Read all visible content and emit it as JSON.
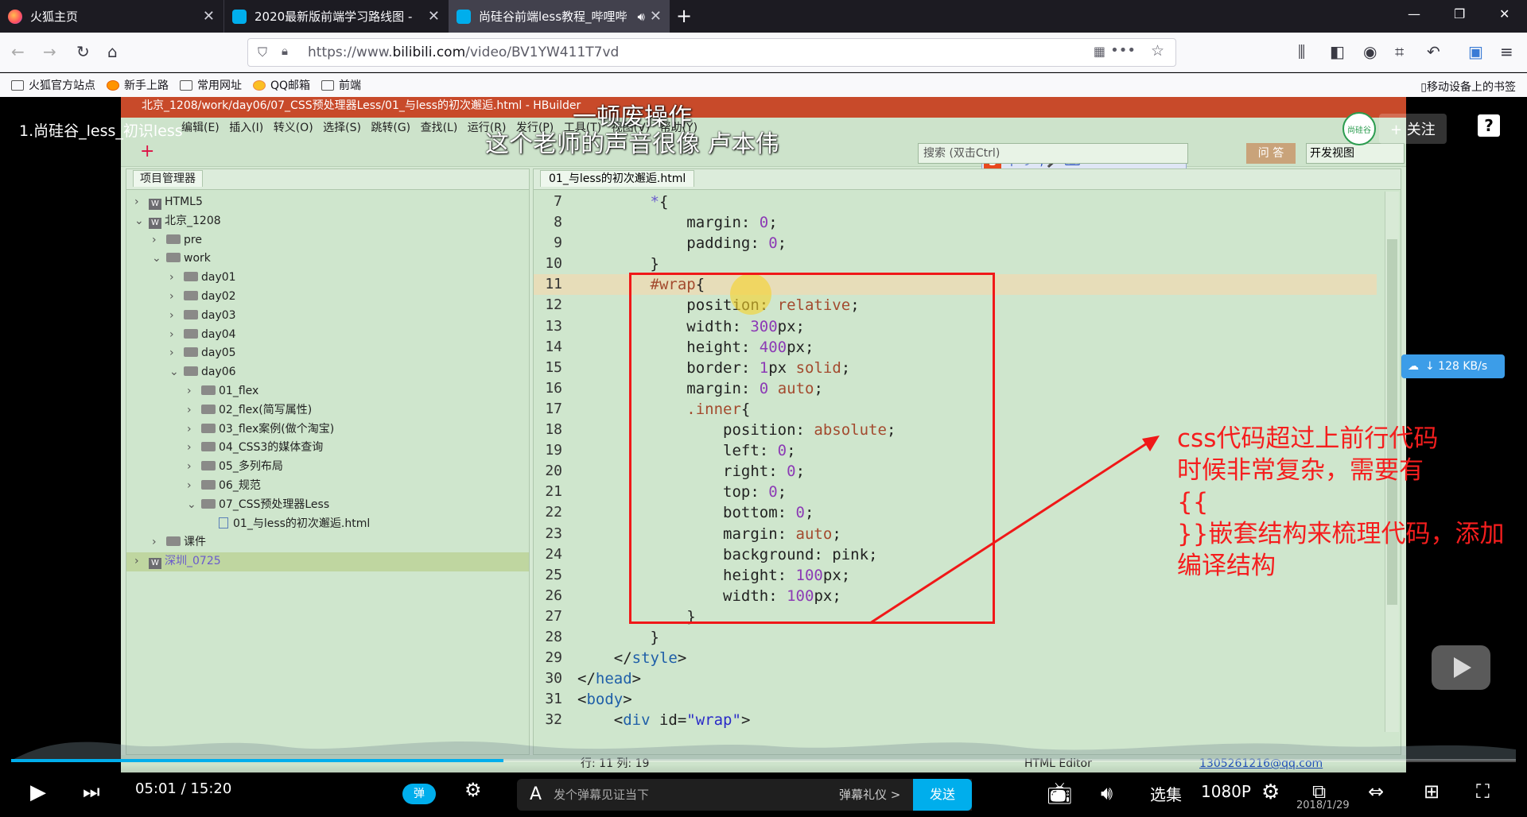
{
  "browser": {
    "tabs": [
      {
        "label": "火狐主页",
        "icon": "firefox-icon",
        "active": false
      },
      {
        "label": "2020最新版前端学习路线图 - ",
        "icon": "bilibili-icon",
        "active": false
      },
      {
        "label": "尚硅谷前端less教程_哔哩哔",
        "icon": "bilibili-icon",
        "active": true
      }
    ],
    "url_prefix": "https://www.",
    "url_domain": "bilibili.com",
    "url_path": "/video/BV1YW411T7vd",
    "bookmarks": [
      "火狐官方站点",
      "新手上路",
      "常用网址",
      "QQ邮箱",
      "前端"
    ],
    "mobile_bookmarks": "移动设备上的书签"
  },
  "video": {
    "title": "1.尚硅谷_less_初识less",
    "danmaku": [
      "一顿废操作",
      "这个老师的声音很像   卢本伟"
    ],
    "follow_label": "+ 关注",
    "avatar_text": "尚硅谷",
    "net_speed": "↓ 128 KB/s",
    "annotation": "css代码超过上前行代码\n时候非常复杂，需要有\n{{\n}}嵌套结构来梳理代码，添加\n编译结构",
    "accent_color": "#00aeec",
    "annotation_color": "#f51e1e"
  },
  "ide": {
    "title": "北京_1208/work/day06/07_CSS预处理器Less/01_与less的初次邂逅.html  -  HBuilder",
    "menu": "编辑(E)  插入(I)  转义(O)  选择(S)  跳转(G)  查找(L)  运行(R)  发行(P)  工具(T)  视图(V)  帮助(Y)",
    "search_placeholder": "搜索 (双击Ctrl)",
    "ask_label": "问 答",
    "view_label": "开发视图",
    "ime_text": "中 ☽ °, 🎤 ⌨",
    "project_panel_title": "项目管理器",
    "tree": [
      {
        "label": "HTML5",
        "depth": 0,
        "kind": "w",
        "arrow": ">"
      },
      {
        "label": "北京_1208",
        "depth": 0,
        "kind": "w",
        "arrow": "v"
      },
      {
        "label": "pre",
        "depth": 1,
        "kind": "folder",
        "arrow": ">"
      },
      {
        "label": "work",
        "depth": 1,
        "kind": "folder",
        "arrow": "v"
      },
      {
        "label": "day01",
        "depth": 2,
        "kind": "folder",
        "arrow": ">"
      },
      {
        "label": "day02",
        "depth": 2,
        "kind": "folder",
        "arrow": ">"
      },
      {
        "label": "day03",
        "depth": 2,
        "kind": "folder",
        "arrow": ">"
      },
      {
        "label": "day04",
        "depth": 2,
        "kind": "folder",
        "arrow": ">"
      },
      {
        "label": "day05",
        "depth": 2,
        "kind": "folder",
        "arrow": ">"
      },
      {
        "label": "day06",
        "depth": 2,
        "kind": "folder",
        "arrow": "v"
      },
      {
        "label": "01_flex",
        "depth": 3,
        "kind": "folder",
        "arrow": ">"
      },
      {
        "label": "02_flex(简写属性)",
        "depth": 3,
        "kind": "folder",
        "arrow": ">"
      },
      {
        "label": "03_flex案例(做个淘宝)",
        "depth": 3,
        "kind": "folder",
        "arrow": ">"
      },
      {
        "label": "04_CSS3的媒体查询",
        "depth": 3,
        "kind": "folder",
        "arrow": ">"
      },
      {
        "label": "05_多列布局",
        "depth": 3,
        "kind": "folder",
        "arrow": ">"
      },
      {
        "label": "06_规范",
        "depth": 3,
        "kind": "folder",
        "arrow": ">"
      },
      {
        "label": "07_CSS预处理器Less",
        "depth": 3,
        "kind": "folder",
        "arrow": "v"
      },
      {
        "label": "01_与less的初次邂逅.html",
        "depth": 4,
        "kind": "file",
        "arrow": ""
      },
      {
        "label": "课件",
        "depth": 1,
        "kind": "folder",
        "arrow": ">"
      },
      {
        "label": "深圳_0725",
        "depth": 0,
        "kind": "w",
        "arrow": ">",
        "selected": true
      }
    ],
    "editor_tab": "01_与less的初次邂逅.html",
    "code": [
      {
        "n": "7",
        "html": "        <span class=\"sel\">*</span>{"
      },
      {
        "n": "8",
        "html": "            margin: <span class=\"n\">0</span>;"
      },
      {
        "n": "9",
        "html": "            padding: <span class=\"n\">0</span>;"
      },
      {
        "n": "10",
        "html": "        }"
      },
      {
        "n": "11",
        "html": "        <span class=\"k\">#wrap</span>{",
        "hl": true
      },
      {
        "n": "12",
        "html": "            position: <span class=\"k\">relative</span>;"
      },
      {
        "n": "13",
        "html": "            width: <span class=\"n\">300</span>px;"
      },
      {
        "n": "14",
        "html": "            height: <span class=\"n\">400</span>px;"
      },
      {
        "n": "15",
        "html": "            border: <span class=\"n\">1</span>px <span class=\"k\">solid</span>;"
      },
      {
        "n": "16",
        "html": "            margin: <span class=\"n\">0</span> <span class=\"k\">auto</span>;"
      },
      {
        "n": "17",
        "html": "            <span class=\"k\">.inner</span>{"
      },
      {
        "n": "18",
        "html": "                position: <span class=\"k\">absolute</span>;"
      },
      {
        "n": "19",
        "html": "                left: <span class=\"n\">0</span>;"
      },
      {
        "n": "20",
        "html": "                right: <span class=\"n\">0</span>;"
      },
      {
        "n": "21",
        "html": "                top: <span class=\"n\">0</span>;"
      },
      {
        "n": "22",
        "html": "                bottom: <span class=\"n\">0</span>;"
      },
      {
        "n": "23",
        "html": "                margin: <span class=\"k\">auto</span>;"
      },
      {
        "n": "24",
        "html": "                background: pink;"
      },
      {
        "n": "25",
        "html": "                height: <span class=\"n\">100</span>px;"
      },
      {
        "n": "26",
        "html": "                width: <span class=\"n\">100</span>px;"
      },
      {
        "n": "27",
        "html": "            }"
      },
      {
        "n": "28",
        "html": "        }"
      },
      {
        "n": "29",
        "html": "    &lt;/<span class=\"t\">style</span>&gt;"
      },
      {
        "n": "30",
        "html": "&lt;/<span class=\"t\">head</span>&gt;"
      },
      {
        "n": "31",
        "html": "&lt;<span class=\"t\">body</span>&gt;"
      },
      {
        "n": "32",
        "html": "    &lt;<span class=\"t\">div</span> id=<span class=\"str\">\"wrap\"</span>&gt;"
      }
    ],
    "status_pos": "行: 11 列: 19",
    "status_editor": "HTML Editor",
    "status_user": "1305261216@qq.com"
  },
  "player": {
    "current_time": "05:01",
    "separator": "/",
    "total_time": "15:20",
    "progress": 0.327,
    "danmaku_toggle": "弹",
    "danmaku_placeholder": "发个弹幕见证当下",
    "danmaku_etiquette": "弹幕礼仪 >",
    "send_label": "发送",
    "episodes_label": "选集",
    "quality_label": "1080P",
    "date_overlay": "2018/1/29"
  }
}
